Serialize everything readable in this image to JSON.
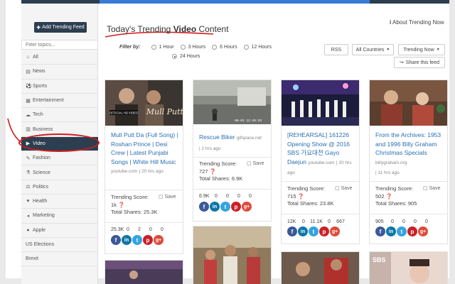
{
  "sidebar": {
    "add_feed_label": "Add Trending Feed",
    "filter_placeholder": "Filter topics...",
    "topics": [
      {
        "label": "All",
        "icon": "home-icon"
      },
      {
        "label": "News",
        "icon": "newspaper-icon"
      },
      {
        "label": "Sports",
        "icon": "ball-icon"
      },
      {
        "label": "Entertainment",
        "icon": "film-icon"
      },
      {
        "label": "Tech",
        "icon": "cloud-icon"
      },
      {
        "label": "Business",
        "icon": "building-icon"
      },
      {
        "label": "Video",
        "icon": "video-icon",
        "active": true
      },
      {
        "label": "Fashion",
        "icon": "tag-icon"
      },
      {
        "label": "Science",
        "icon": "flask-icon"
      },
      {
        "label": "Politics",
        "icon": "gavel-icon"
      },
      {
        "label": "Health",
        "icon": "heart-icon"
      },
      {
        "label": "Marketing",
        "icon": "megaphone-icon"
      },
      {
        "label": "Apple",
        "icon": "apple-icon"
      },
      {
        "label": "US Elections",
        "icon": ""
      },
      {
        "label": "Brexit",
        "icon": ""
      }
    ]
  },
  "header": {
    "title_prefix": "Today's Trending",
    "title_bold": "Video",
    "title_suffix": "Content",
    "about_label": "About Trending Now"
  },
  "filters": {
    "label": "Filter by:",
    "options": [
      "1 Hour",
      "3 Hours",
      "6 Hours",
      "12 Hours",
      "24 Hours"
    ],
    "selected": "24 Hours"
  },
  "toolbar": {
    "rss_label": "RSS",
    "countries_label": "All Countries",
    "sort_label": "Trending Now",
    "share_label": "Share this feed"
  },
  "cards": [
    {
      "title": "Mull Putt Da (Full Song) | Roshan Prince | Desi Crew | Latest Punjabi Songs | White Hill Music",
      "source": "youtube.com",
      "ago": "| 20 hrs ago",
      "score_label": "Trending Score:",
      "score": "1k",
      "shares_label": "Total Shares:",
      "total_shares": "25.3K",
      "save_label": "Save",
      "counts": [
        "25.3K",
        "0",
        "2",
        "0",
        "0"
      ],
      "thumb_text": "Mull Putt DA",
      "thumb_badge": "OFFICIAL HD VIDEO"
    },
    {
      "title": "Rescue Biker",
      "source": "gifspace.net",
      "ago": "| 2 hrs ago",
      "score_label": "Trending Score:",
      "score": "727",
      "shares_label": "Total Shares:",
      "total_shares": "6.9K",
      "save_label": "Save",
      "counts": [
        "6.9K",
        "0",
        "0",
        "0",
        "0"
      ],
      "thumb_text": "06-01 12:49:29"
    },
    {
      "title": "[REHEARSAL] 161226 Opening Show @ 2016 SBS 가요대전 Gayo Daejun",
      "source": "youtube.com",
      "ago": "| 20 hrs ago",
      "score_label": "Trending Score:",
      "score": "715",
      "shares_label": "Total Shares:",
      "total_shares": "23.8K",
      "save_label": "Save",
      "counts": [
        "12K",
        "0",
        "11.1K",
        "0",
        "667"
      ]
    },
    {
      "title": "From the Archives: 1953 and 1996 Billy Graham Christmas Specials",
      "source": "billygraham.org",
      "ago": "| 11 hrs ago",
      "score_label": "Trending Score:",
      "score": "502",
      "shares_label": "Total Shares:",
      "total_shares": "905",
      "save_label": "Save",
      "counts": [
        "905",
        "0",
        "0",
        "0",
        "0"
      ]
    }
  ],
  "bottom_thumbs": [
    "SBS"
  ],
  "colors": {
    "sidebar_active": "#2c3e50",
    "link": "#2a6fb5",
    "annotation": "#d01c1c",
    "facebook": "#3b5998",
    "linkedin": "#0e76a8",
    "twitter": "#33a4e0",
    "pinterest": "#cb2027",
    "googleplus": "#dd4b39"
  }
}
